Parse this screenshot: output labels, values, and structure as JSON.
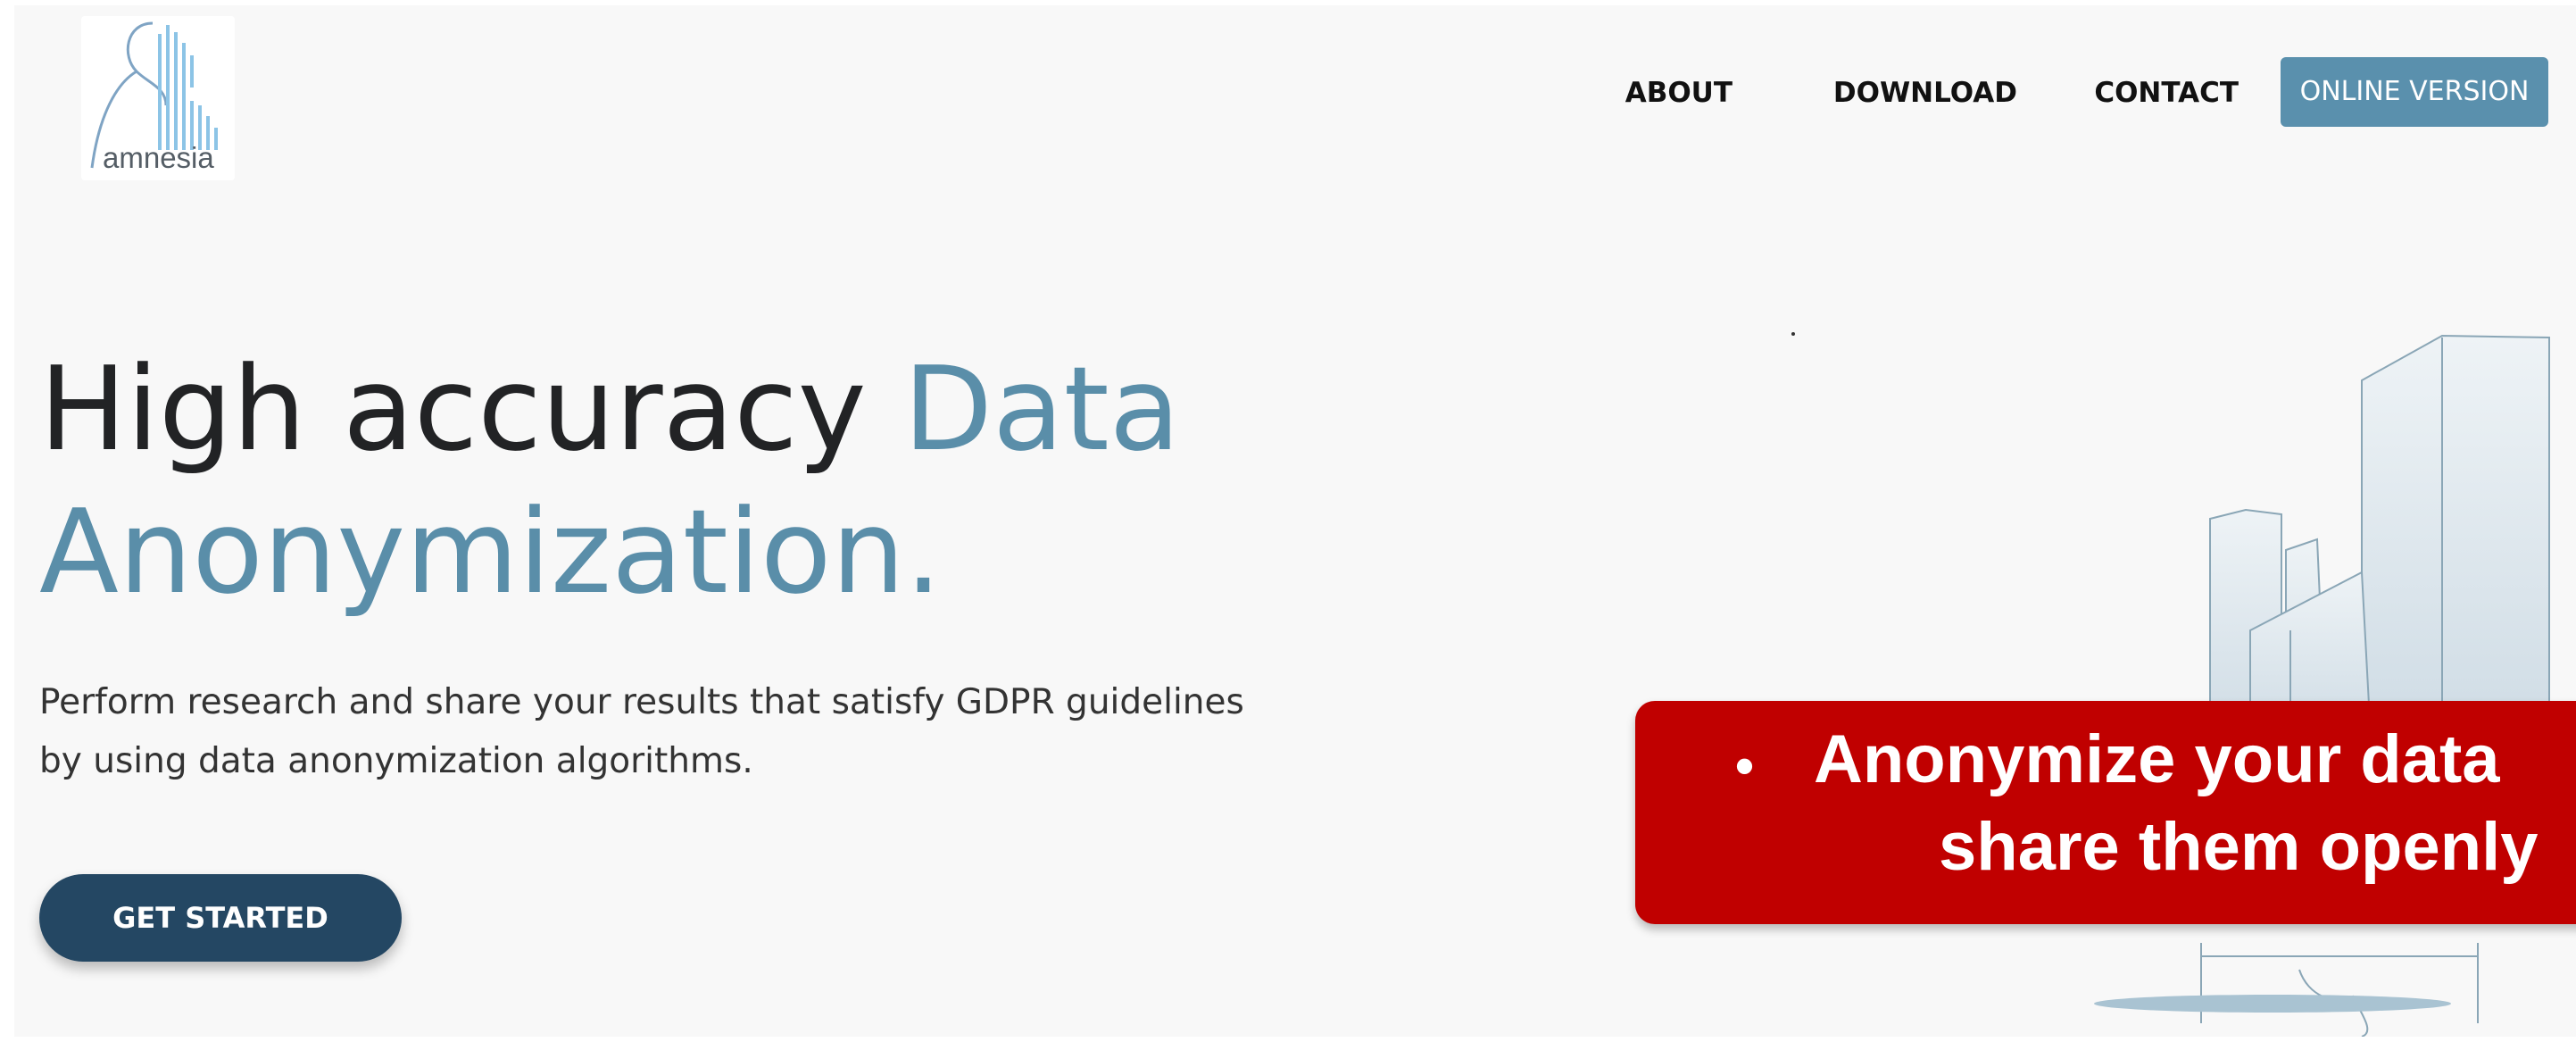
{
  "logo": {
    "text": "amnesia",
    "icon": "amnesia-logo-icon"
  },
  "nav": {
    "about": "ABOUT",
    "download": "DOWNLOAD",
    "contact": "CONTACT",
    "online_version": "ONLINE VERSION"
  },
  "hero": {
    "title_part1": "High accuracy ",
    "title_part2": "Data",
    "title_part3": "Anonymization.",
    "subtitle_line1": "Perform research and share your results that satisfy GDPR guidelines",
    "subtitle_line2": "by using data anonymization algorithms.",
    "cta_label": "GET STARTED"
  },
  "banner": {
    "bullet": "•",
    "line1": "Anonymize your data",
    "line2": "share them openly"
  },
  "colors": {
    "accent": "#5a8ea9",
    "nav_button": "#5a90ad",
    "cta": "#244763",
    "banner": "#c00000",
    "background": "#f8f8f8"
  },
  "illustration": {
    "icon": "city-buildings-illustration"
  }
}
